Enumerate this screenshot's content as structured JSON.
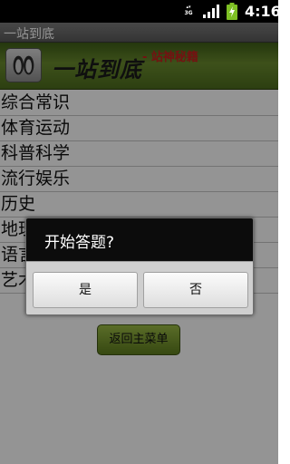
{
  "statusbar": {
    "network": "3G",
    "time": "4:16"
  },
  "titlebar": {
    "title": "一站到底"
  },
  "banner": {
    "title": "一站到底",
    "subtitle": "- 站神秘籍"
  },
  "categories": [
    {
      "label": "综合常识"
    },
    {
      "label": "体育运动"
    },
    {
      "label": "科普科学"
    },
    {
      "label": "流行娱乐"
    },
    {
      "label": "历史"
    },
    {
      "label": "地理"
    },
    {
      "label": "语言"
    },
    {
      "label": "艺术"
    }
  ],
  "back_button": {
    "label": "返回主菜单"
  },
  "dialog": {
    "title": "开始答题?",
    "yes_label": "是",
    "no_label": "否"
  },
  "colors": {
    "banner_green": "#6a8b2e",
    "subtitle_red": "#c81e1e",
    "battery_green": "#7ec024"
  }
}
